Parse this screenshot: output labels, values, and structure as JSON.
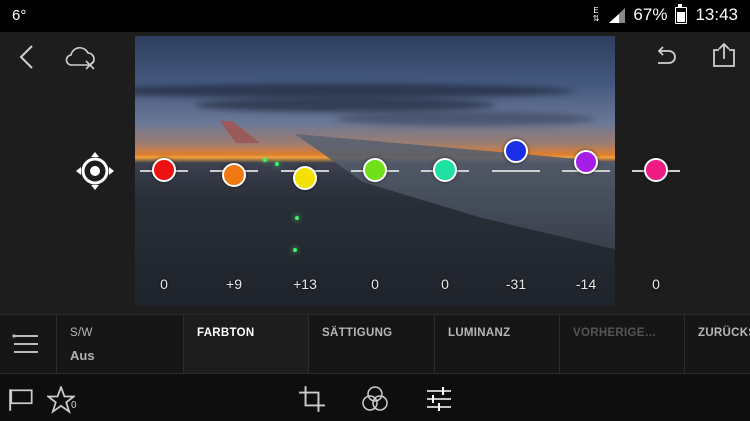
{
  "status": {
    "temperature": "6°",
    "network": "E",
    "battery": "67%",
    "time": "13:43"
  },
  "hsl": {
    "values": [
      "0",
      "+9",
      "+13",
      "0",
      "0",
      "-31",
      "-14",
      "0"
    ],
    "channels": [
      {
        "color": "#ee1111",
        "offset": 0
      },
      {
        "color": "#f07810",
        "offset": 0.09
      },
      {
        "color": "#f5e100",
        "offset": 0.13
      },
      {
        "color": "#6fe01a",
        "offset": 0
      },
      {
        "color": "#1ee0a0",
        "offset": 0
      },
      {
        "color": "#1a2fe6",
        "offset": -0.31
      },
      {
        "color": "#a41ee8",
        "offset": -0.14
      },
      {
        "color": "#f01a85",
        "offset": 0
      }
    ]
  },
  "tabs": {
    "sw": "S/W",
    "sw_value": "Aus",
    "farbton": "FARBTON",
    "saettigung": "SÄTTIGUNG",
    "luminanz": "LUMINANZ",
    "vorherige": "VORHERIGE…",
    "zuruecksetzen": "ZURÜCKSE"
  },
  "rating": {
    "stars": "0"
  },
  "icons": [
    "back-icon",
    "cloud-off-icon",
    "undo-icon",
    "share-icon",
    "target-adjust-icon",
    "menu-icon",
    "flag-icon",
    "star-icon",
    "crop-icon",
    "color-mix-icon",
    "sliders-icon"
  ]
}
